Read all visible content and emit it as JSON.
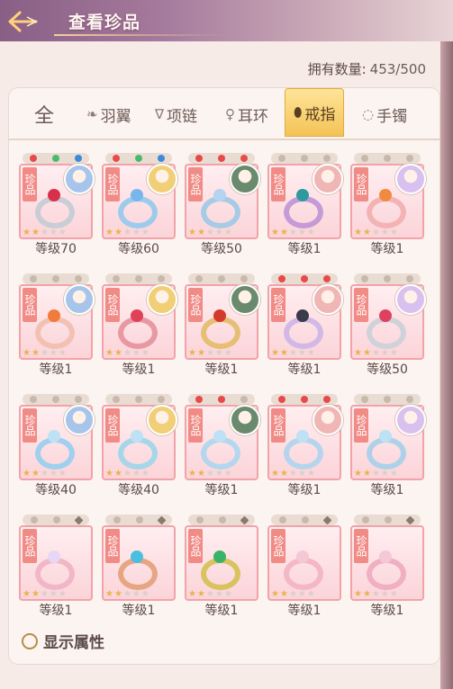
{
  "header": {
    "title": "查看珍品"
  },
  "count": {
    "label": "拥有数量:",
    "value": "453/500"
  },
  "tabs": [
    {
      "label": "全",
      "icon": ""
    },
    {
      "label": "羽翼",
      "icon": "wing-icon"
    },
    {
      "label": "项链",
      "icon": "necklace-icon"
    },
    {
      "label": "耳环",
      "icon": "earring-icon"
    },
    {
      "label": "戒指",
      "icon": "ring-icon",
      "active": true
    },
    {
      "label": "手镯",
      "icon": "bracelet-icon"
    }
  ],
  "items": [
    {
      "tag": "珍品",
      "level": "等级70",
      "dots": [
        "r",
        "g",
        "b"
      ],
      "gem": "#d8304a",
      "ring": "#c8cdd6"
    },
    {
      "tag": "珍品",
      "level": "等级60",
      "dots": [
        "r",
        "g",
        "b"
      ],
      "gem": "#78b7ec",
      "ring": "#9ccbee"
    },
    {
      "tag": "珍品",
      "level": "等级50",
      "dots": [
        "r",
        "r",
        "r"
      ],
      "gem": "#b6d3f0",
      "ring": "#a6cbe6"
    },
    {
      "tag": "珍品",
      "level": "等级1",
      "dots": [
        "",
        "",
        ""
      ],
      "gem": "#2e9aa0",
      "ring": "#c59ad6"
    },
    {
      "tag": "珍品",
      "level": "等级1",
      "dots": [
        "",
        "",
        ""
      ],
      "gem": "#f08a40",
      "ring": "#f3b3b5"
    },
    {
      "tag": "珍品",
      "level": "等级1",
      "dots": [
        "",
        "",
        ""
      ],
      "gem": "#f07b3a",
      "ring": "#f2c1b4"
    },
    {
      "tag": "珍品",
      "level": "等级1",
      "dots": [
        "",
        "",
        ""
      ],
      "gem": "#e24058",
      "ring": "#e898a2"
    },
    {
      "tag": "珍品",
      "level": "等级1",
      "dots": [
        "",
        "",
        ""
      ],
      "gem": "#d33a2a",
      "ring": "#e6be74"
    },
    {
      "tag": "珍品",
      "level": "等级1",
      "dots": [
        "r",
        "r",
        "r"
      ],
      "gem": "#3a3a4a",
      "ring": "#d2b8e6"
    },
    {
      "tag": "珍品",
      "level": "等级50",
      "dots": [
        "",
        "",
        ""
      ],
      "gem": "#e04060",
      "ring": "#cfd2d8"
    },
    {
      "tag": "珍品",
      "level": "等级40",
      "dots": [
        "",
        "",
        ""
      ],
      "gem": "#bfe1f5",
      "ring": "#9fd0ee"
    },
    {
      "tag": "珍品",
      "level": "等级40",
      "dots": [
        "",
        "",
        ""
      ],
      "gem": "#bfe1f5",
      "ring": "#a5d6e9"
    },
    {
      "tag": "珍品",
      "level": "等级1",
      "dots": [
        "r",
        "r",
        ""
      ],
      "gem": "#bfe1f5",
      "ring": "#b3d7ee"
    },
    {
      "tag": "珍品",
      "level": "等级1",
      "dots": [
        "r",
        "r",
        "r"
      ],
      "gem": "#bfe1f5",
      "ring": "#b5d5ee"
    },
    {
      "tag": "珍品",
      "level": "等级1",
      "dots": [
        "",
        "",
        ""
      ],
      "gem": "#bfe1f5",
      "ring": "#aed1ea"
    },
    {
      "tag": "珍品",
      "level": "等级1",
      "dots": [
        "",
        "",
        "d"
      ],
      "gem": "#e6d8f5",
      "ring": "#f1b7c8"
    },
    {
      "tag": "珍品",
      "level": "等级1",
      "dots": [
        "",
        "",
        "d"
      ],
      "gem": "#4ac0e0",
      "ring": "#e7a683"
    },
    {
      "tag": "珍品",
      "level": "等级1",
      "dots": [
        "",
        "",
        "d"
      ],
      "gem": "#39b36a",
      "ring": "#d8c35e"
    },
    {
      "tag": "珍品",
      "level": "等级1",
      "dots": [
        "",
        "",
        "d"
      ],
      "gem": "#f4c8d6",
      "ring": "#f3b7c6"
    },
    {
      "tag": "珍品",
      "level": "等级1",
      "dots": [
        "",
        "",
        "d"
      ],
      "gem": "#f4c8d6",
      "ring": "#f0afc2"
    }
  ],
  "footer": {
    "show_attr_label": "显示属性"
  }
}
